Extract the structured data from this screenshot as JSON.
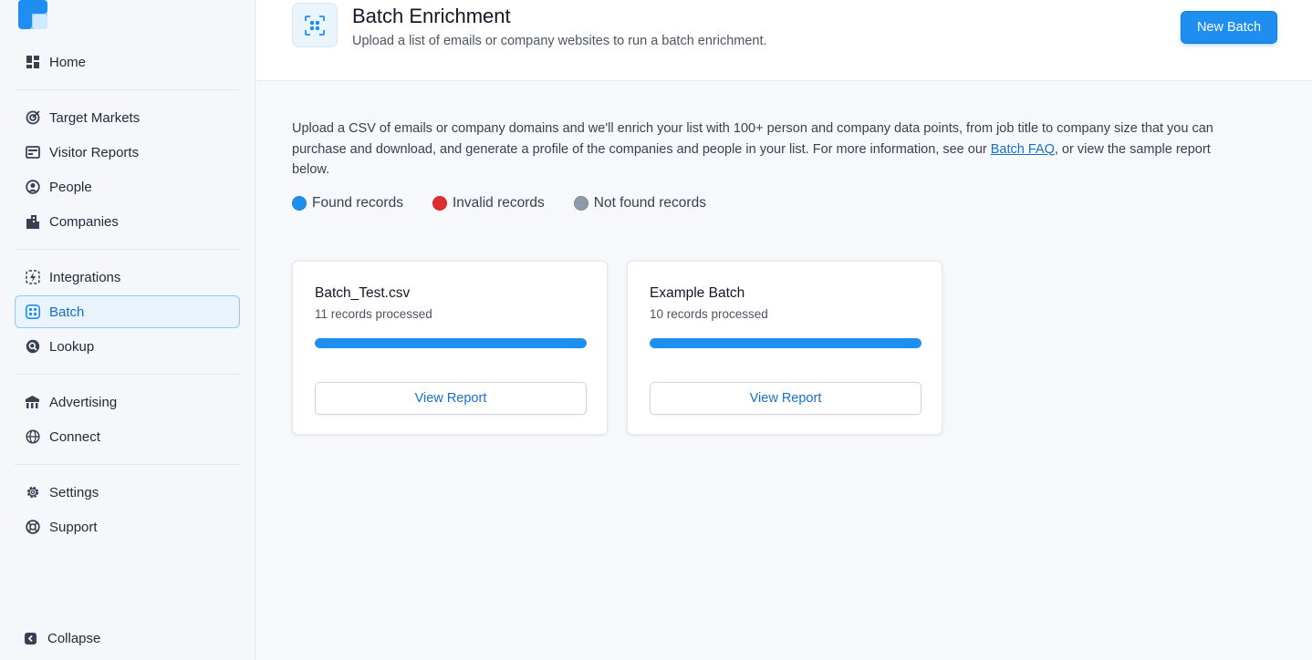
{
  "sidebar": {
    "groups": [
      [
        {
          "label": "Home",
          "icon": "home-icon"
        }
      ],
      [
        {
          "label": "Target Markets",
          "icon": "target-icon"
        },
        {
          "label": "Visitor Reports",
          "icon": "report-icon"
        },
        {
          "label": "People",
          "icon": "person-icon"
        },
        {
          "label": "Companies",
          "icon": "building-icon"
        }
      ],
      [
        {
          "label": "Integrations",
          "icon": "lightning-icon"
        },
        {
          "label": "Batch",
          "icon": "batch-icon",
          "active": true
        },
        {
          "label": "Lookup",
          "icon": "lookup-icon"
        }
      ],
      [
        {
          "label": "Advertising",
          "icon": "megaphone-icon"
        },
        {
          "label": "Connect",
          "icon": "globe-icon"
        }
      ],
      [
        {
          "label": "Settings",
          "icon": "gear-icon"
        },
        {
          "label": "Support",
          "icon": "lifebuoy-icon"
        }
      ]
    ],
    "collapse_label": "Collapse"
  },
  "header": {
    "title": "Batch Enrichment",
    "subtitle": "Upload a list of emails or company websites to run a batch enrichment.",
    "new_batch_label": "New Batch"
  },
  "intro": {
    "text_before": "Upload a CSV of emails or company domains and we'll enrich your list with 100+ person and company data points, from job title to company size that you can purchase and download, and generate a profile of the companies and people in your list. For more information, see our ",
    "link_text": "Batch FAQ",
    "text_after": ", or view the sample report below."
  },
  "legend": [
    {
      "label": "Found records",
      "color": "#1f8ef1"
    },
    {
      "label": "Invalid records",
      "color": "#e02d2d"
    },
    {
      "label": "Not found records",
      "color": "#8c9aab"
    }
  ],
  "batches": [
    {
      "name": "Batch_Test.csv",
      "records": "11 records processed",
      "found_fraction": 1.0,
      "button": "View Report"
    },
    {
      "name": "Example Batch",
      "records": "10 records processed",
      "found_fraction": 1.0,
      "button": "View Report"
    }
  ],
  "colors": {
    "accent": "#1f8ef1",
    "active_bg": "#e8f3fd"
  }
}
